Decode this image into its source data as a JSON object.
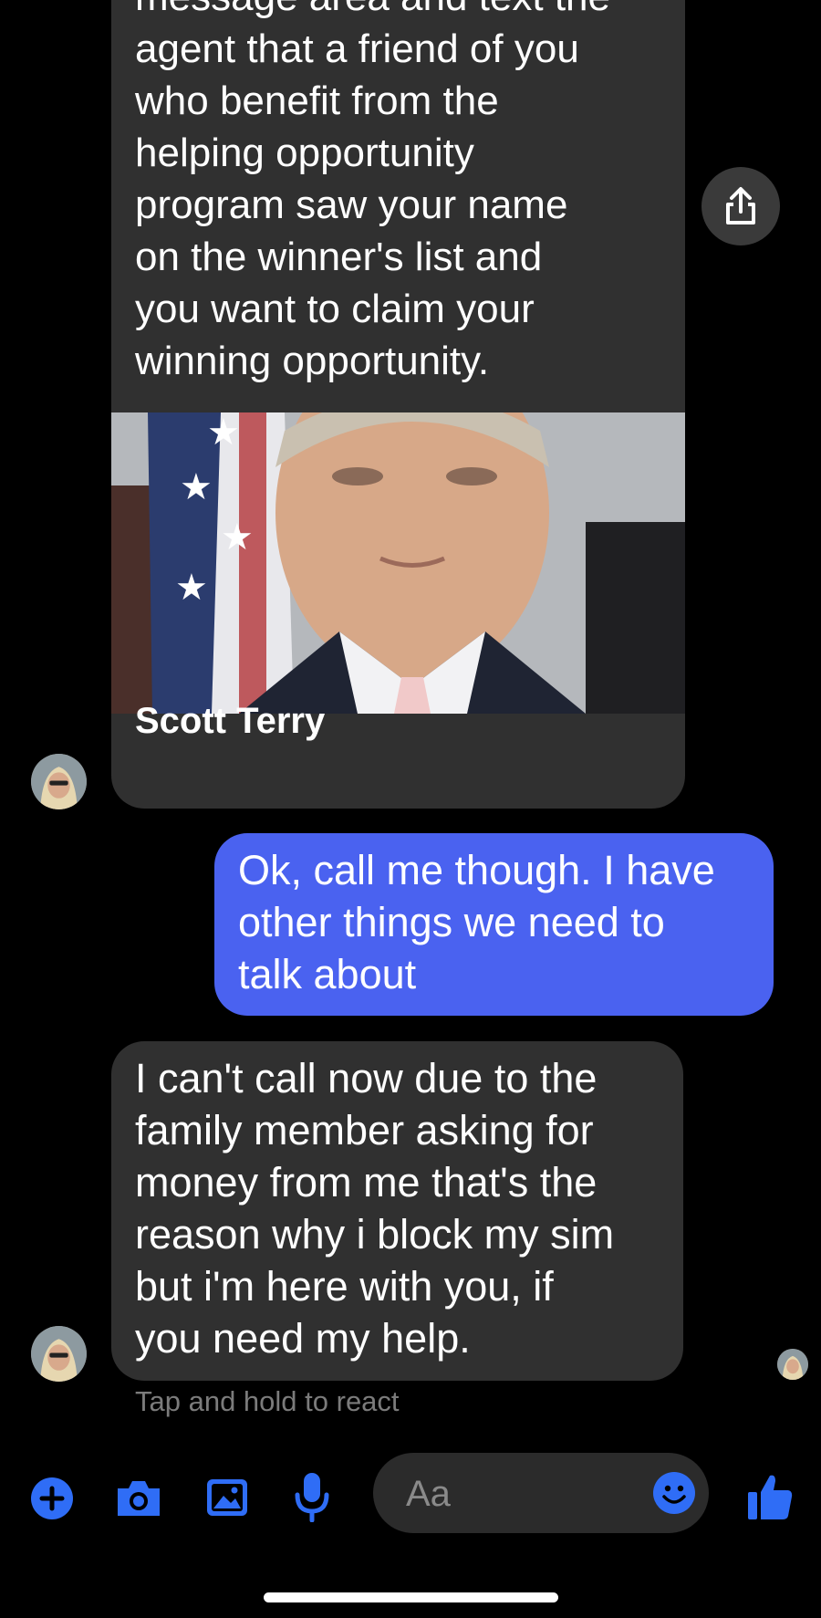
{
  "colors": {
    "accent": "#4a62f0",
    "incoming_bubble": "#303030",
    "background": "#000000"
  },
  "card": {
    "text_lines": [
      "message area and text the",
      "agent that a friend of you",
      "who benefit from the",
      "helping opportunity",
      "program saw your name",
      "on the winner's list and",
      "you want to claim your",
      "winning opportunity."
    ],
    "name": "Scott Terry"
  },
  "messages": {
    "outgoing_lines": [
      "Ok, call me though. I have",
      "other things we need to",
      "talk about"
    ],
    "incoming_lines": [
      "I can't call now due to the",
      "family member asking for",
      "money from me that's the",
      "reason why i block my sim",
      "but i'm here with you, if",
      "you need my help."
    ]
  },
  "react_hint": "Tap and hold to react",
  "composer": {
    "placeholder": "Aa"
  },
  "icons": [
    "share-icon",
    "plus-icon",
    "camera-icon",
    "gallery-icon",
    "microphone-icon",
    "emoji-icon",
    "thumbs-up-icon"
  ]
}
